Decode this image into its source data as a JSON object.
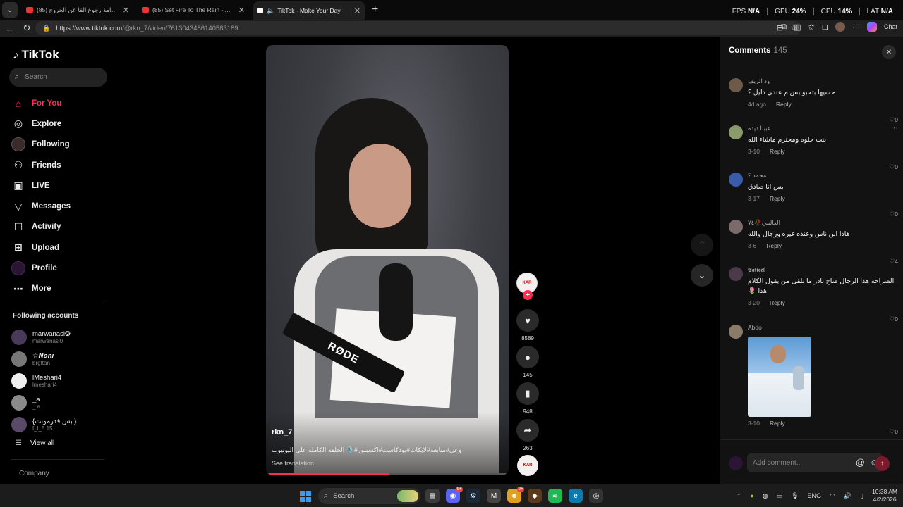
{
  "browser": {
    "tabs": [
      {
        "title": "(85) بث اسامة رجوع الفا عن الخروج ...",
        "favicon": "youtube-icon",
        "active": false
      },
      {
        "title": "(85) Set Fire To The Rain - Adele (L...",
        "favicon": "youtube-icon",
        "active": false
      },
      {
        "title": "TikTok - Make Your Day",
        "favicon": "tiktok-icon",
        "active": true
      }
    ],
    "url_host": "https://www.tiktok.com",
    "url_path": "/@rkn_7/video/7613043486140583189",
    "chat_label": "Chat",
    "stats": {
      "fps_label": "FPS",
      "fps_value": "N/A",
      "gpu_label": "GPU",
      "gpu_value": "24%",
      "cpu_label": "CPU",
      "cpu_value": "14%",
      "lat_label": "LAT",
      "lat_value": "N/A"
    }
  },
  "sidebar": {
    "logo": "TikTok",
    "search_placeholder": "Search",
    "nav": [
      {
        "label": "For You",
        "icon": "home-icon",
        "active": true
      },
      {
        "label": "Explore",
        "icon": "compass-icon"
      },
      {
        "label": "Following",
        "icon": "avatar-icon"
      },
      {
        "label": "Friends",
        "icon": "friends-icon"
      },
      {
        "label": "LIVE",
        "icon": "live-icon"
      },
      {
        "label": "Messages",
        "icon": "send-icon"
      },
      {
        "label": "Activity",
        "icon": "activity-icon"
      },
      {
        "label": "Upload",
        "icon": "upload-icon"
      },
      {
        "label": "Profile",
        "icon": "profile-avatar-icon"
      },
      {
        "label": "More",
        "icon": "more-icon"
      }
    ],
    "following_title": "Following accounts",
    "following": [
      {
        "name": "marwanasi✪",
        "username": "marwanasi0"
      },
      {
        "name": "☆𝑵𝒐𝒏𝒊",
        "username": "brgttan"
      },
      {
        "name": "lMeshari4",
        "username": "lmeshari4"
      },
      {
        "name": "_a",
        "username": "_ a"
      },
      {
        "name": "{بس قدرمونت }",
        "username": "f_l_5.15"
      }
    ],
    "view_all": "View all",
    "company": "Company"
  },
  "video": {
    "author": "rkn_7",
    "caption": "وعي#متابعة#لايكات#بودكاست#اكسبلور#🎙️ الحلقة الكاملة على اليوتيوب",
    "see_translation": "See translation",
    "mic_brand": "RØDE",
    "progress": 0.51,
    "likes": "8589",
    "comments": "145",
    "saves": "948",
    "shares": "263",
    "avatar_text": "KAR"
  },
  "comments": {
    "title": "Comments",
    "count": "145",
    "items": [
      {
        "user": "ود الريف",
        "text": "حسيها بتحبو بس م عندي دليل ؟",
        "time": "4d ago",
        "reply": "Reply",
        "likes": "0"
      },
      {
        "user": "عبينا ديده",
        "text": "بنت حلوه ومحترم ماشاء الله",
        "time": "3-10",
        "reply": "Reply",
        "likes": "0"
      },
      {
        "user": "محمد ؟",
        "text": "بس انا صادق",
        "time": "3-17",
        "reply": "Reply",
        "likes": "0"
      },
      {
        "user": "العالمي🥀٧٤",
        "text": "هاذا ابن ناس وعنده غيره ورجال والله",
        "time": "3-6",
        "reply": "Reply",
        "likes": "4"
      },
      {
        "user": "𝕰𝖆𝖙𝖎𝖊𝖊𝖑",
        "text": "الصراحه هذا الرجال صاح نادر ما تلقى من يقول الكلام هذا 🌷",
        "time": "3-20",
        "reply": "Reply",
        "likes": "0"
      },
      {
        "user": "Abdo",
        "text": "",
        "time": "3-10",
        "reply": "Reply",
        "likes": "0",
        "has_image": true
      }
    ],
    "input_placeholder": "Add comment..."
  },
  "taskbar": {
    "search": "Search",
    "lang": "ENG",
    "time": "10:38 AM",
    "date": "4/2/2026"
  }
}
